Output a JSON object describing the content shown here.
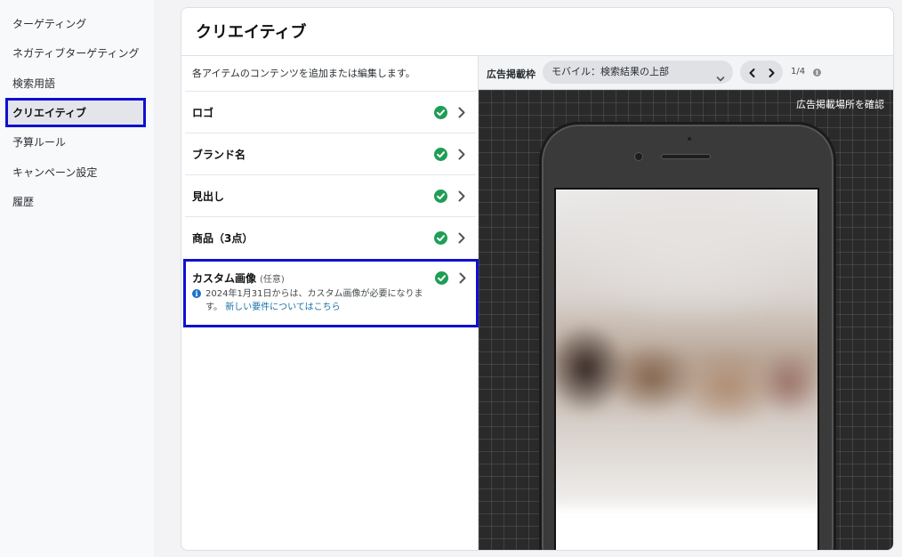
{
  "sidebar": {
    "items": [
      {
        "label": "ターゲティング"
      },
      {
        "label": "ネガティブターゲティング"
      },
      {
        "label": "検索用語"
      },
      {
        "label": "クリエイティブ"
      },
      {
        "label": "予算ルール"
      },
      {
        "label": "キャンペーン設定"
      },
      {
        "label": "履歴"
      }
    ],
    "active_index": 3
  },
  "card": {
    "title": "クリエイティブ"
  },
  "items_panel": {
    "description": "各アイテムのコンテンツを追加または編集します。",
    "items": [
      {
        "label": "ロゴ",
        "status": "complete"
      },
      {
        "label": "ブランド名",
        "status": "complete"
      },
      {
        "label": "見出し",
        "status": "complete"
      },
      {
        "label": "商品（3点）",
        "status": "complete"
      },
      {
        "label": "カスタム画像",
        "optional_tag": "(任意)",
        "status": "complete"
      }
    ],
    "notice": {
      "text": "2024年1月31日からは、カスタム画像が必要になります。",
      "link": "新しい要件についてはこちら"
    }
  },
  "preview": {
    "placement_label": "広告掲載枠",
    "placement_value": "モバイル：検索結果の上部",
    "page_indicator": "1/4",
    "confirm_link": "広告掲載場所を確認"
  },
  "icons": {
    "check": "check-circle-icon",
    "chevron_right": "chevron-right-icon",
    "info": "info-icon"
  },
  "colors": {
    "highlight_border": "#1010d0",
    "check_green": "#1f9d55",
    "link_blue": "#1a6fa5"
  }
}
